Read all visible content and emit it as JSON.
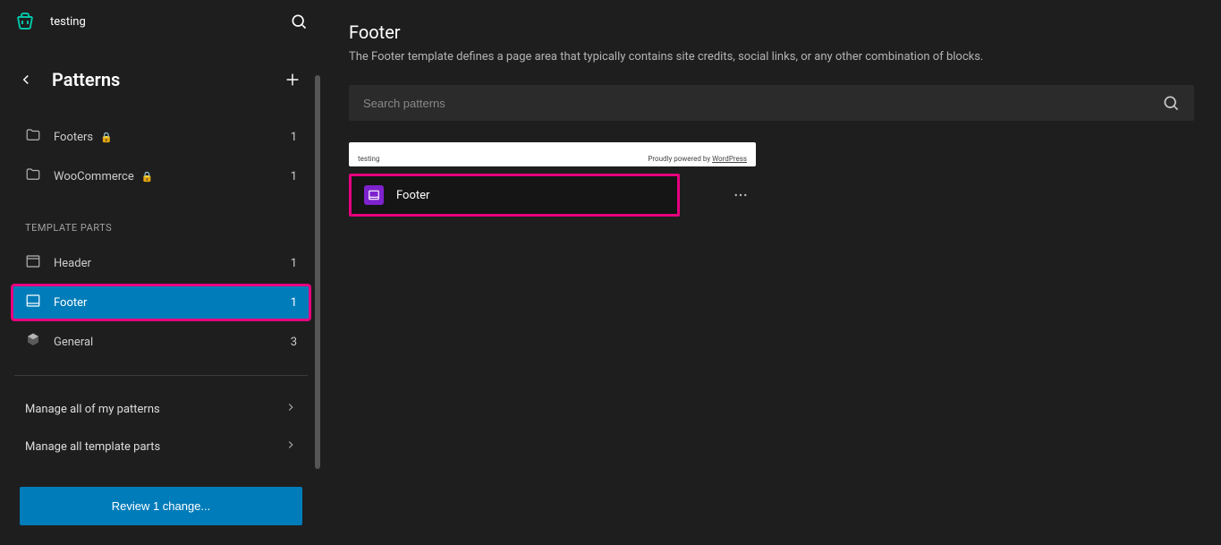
{
  "site_title": "testing",
  "sidebar": {
    "back_title": "Patterns",
    "pattern_categories": [
      {
        "label": "Footers",
        "locked": true,
        "count": 1
      },
      {
        "label": "WooCommerce",
        "locked": true,
        "count": 1
      }
    ],
    "section_label": "TEMPLATE PARTS",
    "template_parts": [
      {
        "label": "Header",
        "count": 1,
        "active": false
      },
      {
        "label": "Footer",
        "count": 1,
        "active": true
      },
      {
        "label": "General",
        "count": 3,
        "active": false
      }
    ],
    "manage_patterns_label": "Manage all of my patterns",
    "manage_parts_label": "Manage all template parts",
    "review_button": "Review 1 change..."
  },
  "main": {
    "title": "Footer",
    "description": "The Footer template defines a page area that typically contains site credits, social links, or any other combination of blocks.",
    "search_placeholder": "Search patterns",
    "preview": {
      "left": "testing",
      "right_prefix": "Proudly powered by ",
      "right_link": "WordPress"
    },
    "card_label": "Footer"
  }
}
